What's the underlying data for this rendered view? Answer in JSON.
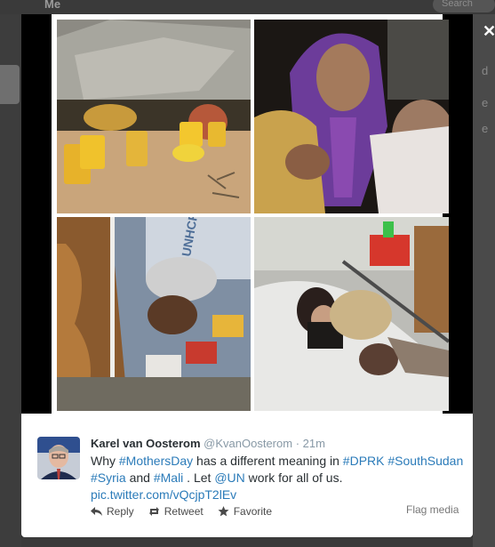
{
  "background": {
    "topbar_label": "Me",
    "search_placeholder": "Search",
    "right_edge_letters": [
      "d",
      "e",
      "e"
    ]
  },
  "modal": {
    "close_glyph": "✕",
    "photos": [
      {
        "unhcr_text": ""
      },
      {
        "unhcr_text": ""
      },
      {
        "unhcr_text": "UNHCR"
      },
      {
        "unhcr_text": ""
      }
    ]
  },
  "tweet": {
    "display_name": "Karel van Oosterom",
    "handle": "@KvanOosterom",
    "separator": "·",
    "time": "21m",
    "text": {
      "t1": "Why ",
      "h1": "#MothersDay",
      "t2": " has a different meaning in ",
      "h2": "#DPRK",
      "t3": " ",
      "h3": "#SouthSudan",
      "t4": " ",
      "h4": "#Syria",
      "t5": " and ",
      "h5": "#Mali",
      "t6": " . Let ",
      "m1": "@UN",
      "t7": " work for all of us.",
      "link": "pic.twitter.com/vQcjpT2lEv"
    },
    "actions": {
      "reply": "Reply",
      "retweet": "Retweet",
      "favorite": "Favorite",
      "flag_media": "Flag media"
    }
  },
  "colors": {
    "link": "#2b7bb9",
    "name": "#292f33",
    "meta": "#8899a6",
    "overlay": "#2b2b2b"
  }
}
